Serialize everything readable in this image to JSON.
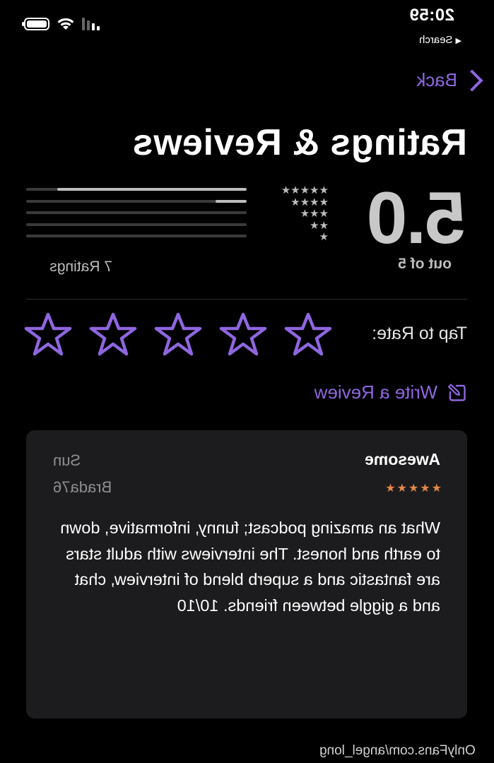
{
  "status_bar": {
    "time": "20:59",
    "back_app": "Search"
  },
  "nav": {
    "back_label": "Back"
  },
  "page": {
    "title": "Ratings & Reviews"
  },
  "summary": {
    "score": "5.0",
    "out_of": "out of 5",
    "ratings_count": "7 Ratings",
    "distribution": [
      {
        "stars": 5,
        "fraction": 0.86
      },
      {
        "stars": 4,
        "fraction": 0.14
      },
      {
        "stars": 3,
        "fraction": 0
      },
      {
        "stars": 2,
        "fraction": 0
      },
      {
        "stars": 1,
        "fraction": 0
      }
    ]
  },
  "tap_to_rate": {
    "label": "Tap to Rate:",
    "star_count": 5
  },
  "write_review": {
    "label": "Write a Review"
  },
  "review": {
    "title": "Awesome",
    "date": "Sun",
    "author": "Brada76",
    "rating": 5,
    "body": "What an amazing podcast; funny, informative, down to earth and honest. The interviews with adult stars are fantastic and a superb blend of interview, chat and a giggle between friends. 10/10"
  },
  "watermark": "OnlyFans.com/angel_long",
  "colors": {
    "accent": "#8f66e0",
    "review_star": "#e5874a",
    "bar_fill": "#bdbdbd",
    "card_bg": "#1c1c1e"
  }
}
